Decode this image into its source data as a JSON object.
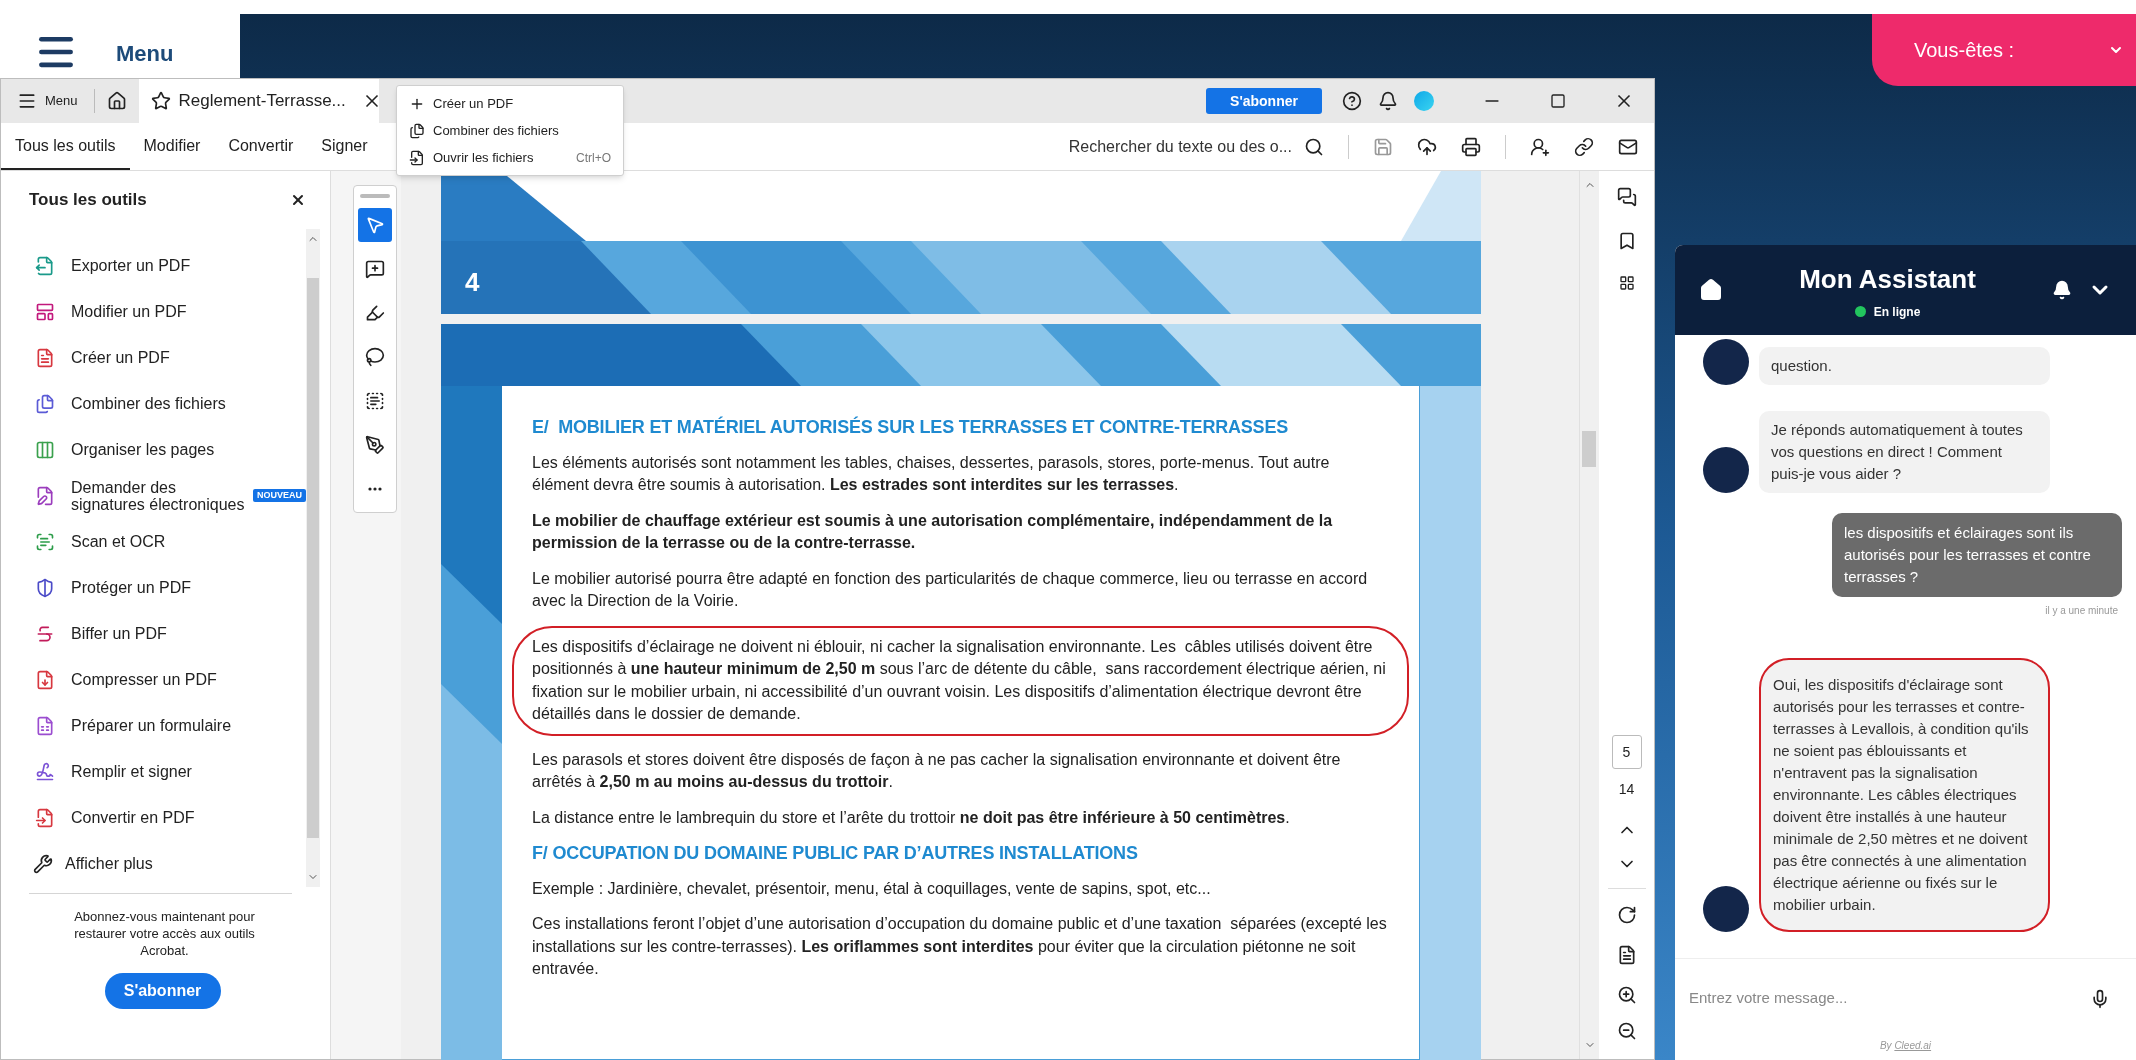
{
  "website": {
    "menu_label": "Menu",
    "audience_select": "Vous-êtes :"
  },
  "acrobat": {
    "title_bar": {
      "menu": "Menu",
      "tab_title": "Reglement-Terrasse...",
      "subscribe": "S'abonner"
    },
    "dropdown": [
      {
        "label": "Créer un PDF"
      },
      {
        "label": "Combiner des fichiers"
      },
      {
        "label": "Ouvrir les fichiers",
        "shortcut": "Ctrl+O"
      }
    ],
    "toolbar_tabs": [
      {
        "label": "Tous les outils",
        "selected": true
      },
      {
        "label": "Modifier",
        "selected": false
      },
      {
        "label": "Convertir",
        "selected": false
      },
      {
        "label": "Signer",
        "selected": false
      }
    ],
    "search_placeholder": "Rechercher du texte ou des o...",
    "tools_panel": {
      "title": "Tous les outils",
      "items": [
        {
          "label": "Exporter un PDF",
          "color": "#1a9a8a"
        },
        {
          "label": "Modifier un PDF",
          "color": "#c2187c"
        },
        {
          "label": "Créer un PDF",
          "color": "#d7373f"
        },
        {
          "label": "Combiner des fichiers",
          "color": "#5b5bd6"
        },
        {
          "label": "Organiser les pages",
          "color": "#3aa14d"
        },
        {
          "label": "Demander des signatures électroniques",
          "color": "#9b3dbd",
          "badge": "NOUVEAU"
        },
        {
          "label": "Scan et OCR",
          "color": "#2d9d4a"
        },
        {
          "label": "Protéger un PDF",
          "color": "#4b4bc8"
        },
        {
          "label": "Biffer un PDF",
          "color": "#c21b5a"
        },
        {
          "label": "Compresser un PDF",
          "color": "#d7373f"
        },
        {
          "label": "Préparer un formulaire",
          "color": "#9b4dd0"
        },
        {
          "label": "Remplir et signer",
          "color": "#7b52d6"
        },
        {
          "label": "Convertir en PDF",
          "color": "#d7373f"
        }
      ],
      "more": "Afficher plus",
      "promo": "Abonnez-vous maintenant pour restaurer votre accès aux outils Acrobat.",
      "subscribe": "S'abonner"
    },
    "tool_strip": [
      {
        "selected": true
      },
      {
        "selected": false
      },
      {
        "selected": false
      },
      {
        "selected": false
      },
      {
        "selected": false
      },
      {
        "selected": false
      },
      {
        "selected": false
      }
    ],
    "document": {
      "page_number": "4",
      "blocks": [
        {
          "kind": "heading",
          "circled": false,
          "text": "E/  MOBILIER ET MATÉRIEL AUTORISÉS SUR LES TERRASSES ET CONTRE-TERRASSES"
        },
        {
          "kind": "paragraph",
          "circled": false,
          "text": "Les éléments autorisés sont notamment les tables, chaises, dessertes, parasols, stores, porte-menus. Tout autre élément devra être soumis à autorisation. **Les estrades sont interdites sur les terrasses**."
        },
        {
          "kind": "strong",
          "circled": false,
          "text": "Le mobilier de chauffage extérieur est soumis à une autorisation complémentaire, indépendamment de la permission de la terrasse ou de la contre-terrasse."
        },
        {
          "kind": "paragraph",
          "circled": false,
          "text": "Le mobilier autorisé pourra être adapté en fonction des particularités de chaque commerce, lieu ou terrasse en accord avec la Direction de la Voirie."
        },
        {
          "kind": "paragraph",
          "circled": true,
          "text": "Les dispositifs d’éclairage ne doivent ni éblouir, ni cacher la signalisation environnante. Les  câbles utilisés doivent être positionnés à **une hauteur minimum de 2,50 m** sous l’arc de détente du câble,  sans raccordement électrique aérien, ni fixation sur le mobilier urbain, ni accessibilité d’un ouvrant voisin. Les dispositifs d’alimentation électrique devront être détaillés dans le dossier de demande."
        },
        {
          "kind": "paragraph",
          "circled": false,
          "text": "Les parasols et stores doivent être disposés de façon à ne pas cacher la signalisation environnante et doivent être arrêtés à **2,50 m au moins au-dessus du trottoir**."
        },
        {
          "kind": "paragraph",
          "circled": false,
          "text": "La distance entre le lambrequin du store et l’arête du trottoir **ne doit pas être inférieure à 50 centimètres**."
        },
        {
          "kind": "heading",
          "circled": false,
          "text": "F/ OCCUPATION DU DOMAINE PUBLIC PAR D’AUTRES INSTALLATIONS"
        },
        {
          "kind": "paragraph",
          "circled": false,
          "text": "Exemple : Jardinière, chevalet, présentoir, menu, étal à coquillages, vente de sapins, spot, etc..."
        },
        {
          "kind": "paragraph",
          "circled": false,
          "text": "Ces installations feront l’objet d’une autorisation d’occupation du domaine public et d’une taxation  séparées (excepté les installations sur les contre-terrasses). **Les oriflammes sont interdites** pour éviter que la circulation piétonne ne soit entravée."
        }
      ]
    },
    "page_nav": {
      "current": "5",
      "total": "14"
    }
  },
  "chat": {
    "title": "Mon Assistant",
    "status": "En ligne",
    "messages": [
      {
        "kind": "bot",
        "circled": false,
        "text": "question."
      },
      {
        "kind": "bot",
        "circled": false,
        "text": "Je réponds automatiquement à toutes vos questions en direct ! Comment puis-je vous aider ?"
      },
      {
        "kind": "user",
        "circled": false,
        "text": "les dispositifs et éclairages sont ils autorisés pour les terrasses et contre terrasses ?",
        "time": "il y a une minute"
      },
      {
        "kind": "bot",
        "circled": true,
        "text": "Oui, les dispositifs d'éclairage sont autorisés pour les terrasses et contre-terrasses à Levallois, à condition qu'ils ne soient pas éblouissants et n'entravent pas la signalisation environnante. Les câbles électriques doivent être installés à une hauteur minimale de 2,50 mètres et ne doivent pas être connectés à une alimentation électrique aérienne ou fixés sur le mobilier urbain."
      }
    ],
    "input_placeholder": "Entrez votre message...",
    "footer_prefix": "By",
    "footer_link": "Cleed.ai"
  }
}
